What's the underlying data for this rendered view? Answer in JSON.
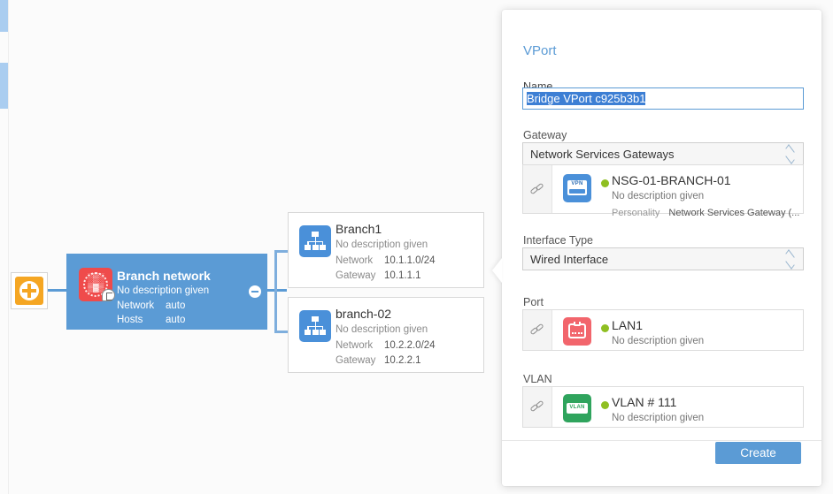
{
  "canvas": {
    "domain_node": {
      "icon": "domain-router-icon"
    },
    "selected_node": {
      "title": "Branch network",
      "description": "No description given",
      "rows": [
        {
          "key": "Network",
          "value": "auto"
        },
        {
          "key": "Hosts",
          "value": "auto"
        }
      ],
      "icon": "subnet-network-icon",
      "badge_icon": "comment-badge-icon",
      "collapse_icon": "minus-circle-icon"
    },
    "branches": [
      {
        "title": "Branch1",
        "description": "No description given",
        "rows": [
          {
            "key": "Network",
            "value": "10.1.1.0/24"
          },
          {
            "key": "Gateway",
            "value": "10.1.1.1"
          }
        ],
        "icon": "sitemap-icon"
      },
      {
        "title": "branch-02",
        "description": "No description given",
        "rows": [
          {
            "key": "Network",
            "value": "10.2.2.0/24"
          },
          {
            "key": "Gateway",
            "value": "10.2.2.1"
          }
        ],
        "icon": "sitemap-icon"
      }
    ]
  },
  "panel": {
    "title": "VPort",
    "name": {
      "label": "Name",
      "value": "Bridge VPort c925b3b1"
    },
    "gateway": {
      "label": "Gateway",
      "select_value": "Network Services Gateways",
      "select_icon": "spinner-updown-icon",
      "entity": {
        "title": "NSG-01-BRANCH-01",
        "description": "No description given",
        "meta_key": "Personality",
        "meta_value": "Network Services Gateway (...",
        "icon": "vpn-gateway-icon",
        "link_icon": "chain-link-icon",
        "status_color": "#8fbf22"
      }
    },
    "interface_type": {
      "label": "Interface Type",
      "select_value": "Wired Interface",
      "select_icon": "spinner-updown-icon"
    },
    "port": {
      "label": "Port",
      "entity": {
        "title": "LAN1",
        "description": "No description given",
        "icon": "lan-port-icon",
        "link_icon": "chain-link-icon",
        "status_color": "#8fbf22"
      }
    },
    "vlan": {
      "label": "VLAN",
      "entity": {
        "title": "VLAN # 111",
        "description": "No description given",
        "icon": "vlan-tag-icon",
        "link_icon": "chain-link-icon",
        "status_color": "#8fbf22"
      }
    },
    "create_label": "Create"
  },
  "colors": {
    "accent": "#5b9bd5",
    "selected_node": "#5b9bd5",
    "status_green": "#8fbf22",
    "domain_orange": "#f5a623",
    "network_red": "#ef4b4b",
    "vlan_green": "#2fa45d",
    "lan_red": "#f2656c"
  }
}
